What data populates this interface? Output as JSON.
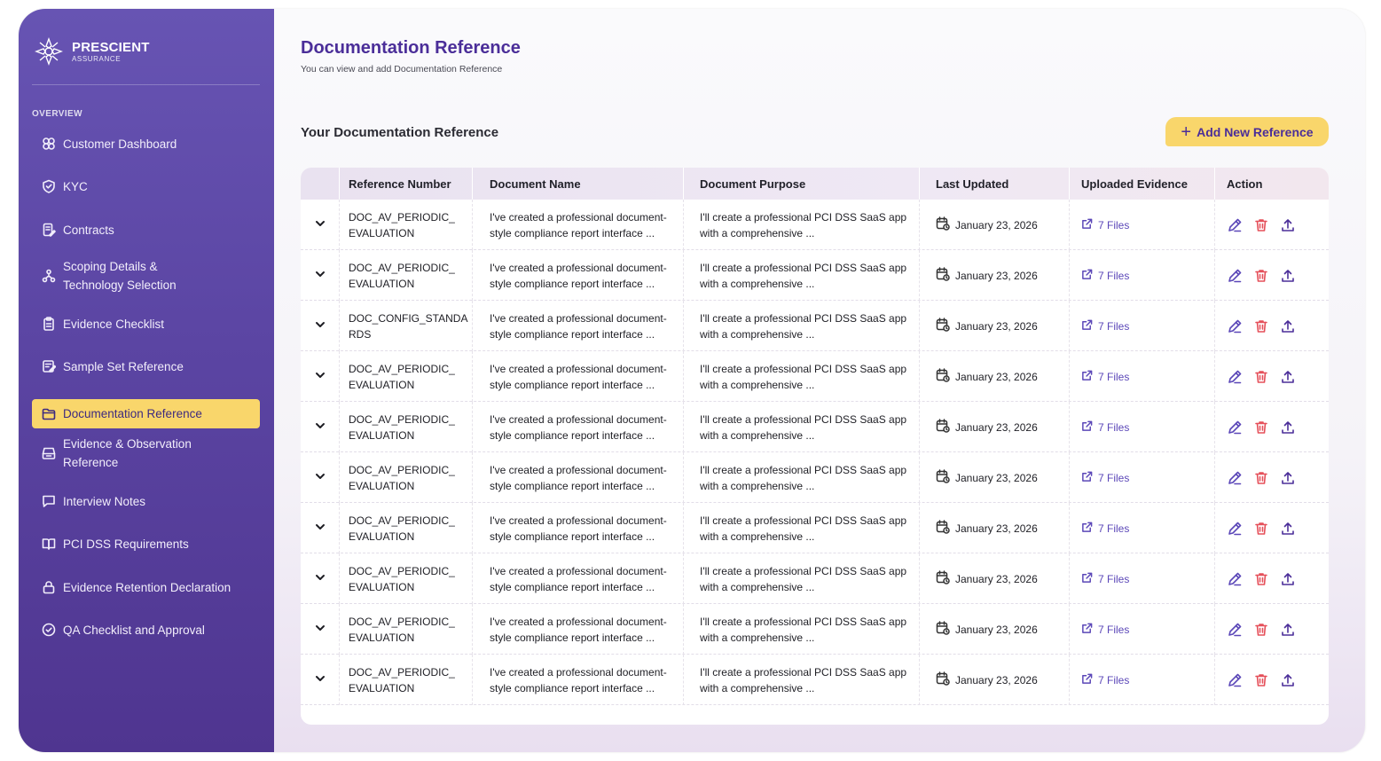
{
  "brand": {
    "name": "PRESCIENT",
    "sub": "ASSURANCE"
  },
  "sidebar": {
    "section_label": "OVERVIEW",
    "items": [
      {
        "label": "Customer Dashboard",
        "icon": "grid-icon"
      },
      {
        "label": "KYC",
        "icon": "shield-check-icon"
      },
      {
        "label": "Contracts",
        "icon": "contract-icon"
      },
      {
        "label": "Scoping Details &\nTechnology Selection",
        "icon": "network-icon"
      },
      {
        "label": "Evidence Checklist",
        "icon": "clipboard-icon"
      },
      {
        "label": "Sample Set Reference",
        "icon": "edit-list-icon"
      },
      {
        "label": "Documentation Reference",
        "icon": "folder-icon",
        "active": true
      },
      {
        "label": "Evidence & Observation\nReference",
        "icon": "tray-icon"
      },
      {
        "label": "Interview Notes",
        "icon": "message-icon"
      },
      {
        "label": "PCI DSS Requirements",
        "icon": "book-icon"
      },
      {
        "label": "Evidence Retention Declaration",
        "icon": "lock-icon"
      },
      {
        "label": "QA Checklist and Approval",
        "icon": "check-circle-icon"
      }
    ]
  },
  "header": {
    "title": "Documentation Reference",
    "subtitle": "You can view and add Documentation Reference"
  },
  "section": {
    "title": "Your Documentation Reference",
    "add_button": "Add New Reference"
  },
  "table": {
    "columns": [
      "Reference Number",
      "Document Name",
      "Document Purpose",
      "Last Updated",
      "Uploaded Evidence",
      "Action"
    ],
    "rows": [
      {
        "ref": "DOC_AV_PERIODIC_\nEVALUATION",
        "name": "I've created a professional document-\nstyle compliance report interface ...",
        "purpose": "I'll create a professional PCI DSS SaaS app\nwith a comprehensive ...",
        "updated": "January 23, 2026",
        "evidence": "7 Files"
      },
      {
        "ref": "DOC_AV_PERIODIC_\nEVALUATION",
        "name": "I've created a professional document-\nstyle compliance report interface ...",
        "purpose": "I'll create a professional PCI DSS SaaS app\nwith a comprehensive ...",
        "updated": "January 23, 2026",
        "evidence": "7 Files"
      },
      {
        "ref": "DOC_CONFIG_STANDA\nRDS",
        "name": "I've created a professional document-\nstyle compliance report interface ...",
        "purpose": "I'll create a professional PCI DSS SaaS app\nwith a comprehensive ...",
        "updated": "January 23, 2026",
        "evidence": "7 Files"
      },
      {
        "ref": "DOC_AV_PERIODIC_\nEVALUATION",
        "name": "I've created a professional document-\nstyle compliance report interface ...",
        "purpose": "I'll create a professional PCI DSS SaaS app\nwith a comprehensive ...",
        "updated": "January 23, 2026",
        "evidence": "7 Files"
      },
      {
        "ref": "DOC_AV_PERIODIC_\nEVALUATION",
        "name": "I've created a professional document-\nstyle compliance report interface ...",
        "purpose": "I'll create a professional PCI DSS SaaS app\nwith a comprehensive ...",
        "updated": "January 23, 2026",
        "evidence": "7 Files"
      },
      {
        "ref": "DOC_AV_PERIODIC_\nEVALUATION",
        "name": "I've created a professional document-\nstyle compliance report interface ...",
        "purpose": "I'll create a professional PCI DSS SaaS app\nwith a comprehensive ...",
        "updated": "January 23, 2026",
        "evidence": "7 Files"
      },
      {
        "ref": "DOC_AV_PERIODIC_\nEVALUATION",
        "name": "I've created a professional document-\nstyle compliance report interface ...",
        "purpose": "I'll create a professional PCI DSS SaaS app\nwith a comprehensive ...",
        "updated": "January 23, 2026",
        "evidence": "7 Files"
      },
      {
        "ref": "DOC_AV_PERIODIC_\nEVALUATION",
        "name": "I've created a professional document-\nstyle compliance report interface ...",
        "purpose": "I'll create a professional PCI DSS SaaS app\nwith a comprehensive ...",
        "updated": "January 23, 2026",
        "evidence": "7 Files"
      },
      {
        "ref": "DOC_AV_PERIODIC_\nEVALUATION",
        "name": "I've created a professional document-\nstyle compliance report interface ...",
        "purpose": "I'll create a professional PCI DSS SaaS app\nwith a comprehensive ...",
        "updated": "January 23, 2026",
        "evidence": "7 Files"
      },
      {
        "ref": "DOC_AV_PERIODIC_\nEVALUATION",
        "name": "I've created a professional document-\nstyle compliance report interface ...",
        "purpose": "I'll create a professional PCI DSS SaaS app\nwith a comprehensive ...",
        "updated": "January 23, 2026",
        "evidence": "7 Files"
      }
    ]
  },
  "colors": {
    "sidebar": "#5b45a3",
    "accent": "#f9d66b",
    "primary_text": "#4b2e99",
    "delete": "#e5505a"
  }
}
